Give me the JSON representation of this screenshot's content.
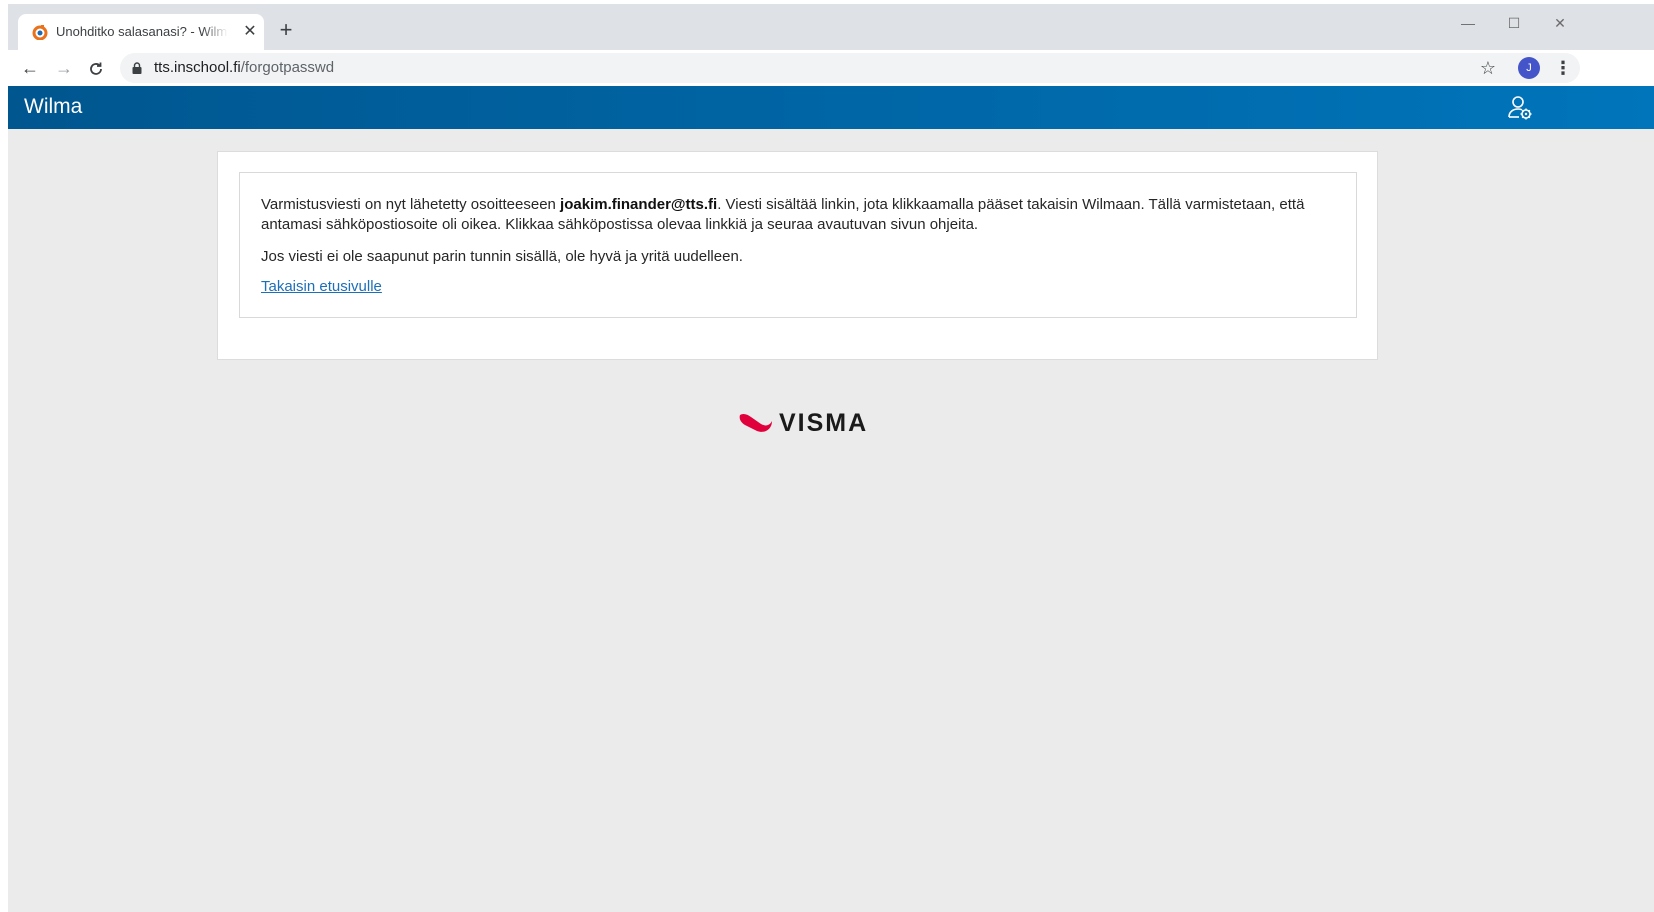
{
  "browser": {
    "tab_title": "Unohditko salasanasi? - Wilma - ",
    "tab_close": "✕",
    "new_tab": "+",
    "window_controls": {
      "minimize": "—",
      "maximize": "☐",
      "close": "✕"
    },
    "nav": {
      "back": "←",
      "forward": "→",
      "reload": "C"
    },
    "url_host": "tts.inschool.fi",
    "url_path": "/forgotpasswd",
    "star": "☆",
    "profile_initial": "J",
    "menu": "⋮",
    "accent_colors": {
      "favicon_ring": "#e8731c",
      "favicon_center": "#1c6bb4",
      "profile": "#4355c9"
    }
  },
  "app": {
    "brand": "Wilma",
    "header_gradient": [
      "#00568f",
      "#0075bb"
    ],
    "account_icon": "user-settings-icon"
  },
  "message": {
    "text_before": "Varmistusviesti on nyt lähetetty osoitteeseen ",
    "email": "joakim.finander@tts.fi",
    "text_after": ". Viesti sisältää linkin, jota klikkaamalla pääset takaisin Wilmaan. Tällä varmistetaan, että antamasi sähköpostiosoite oli oikea. Klikkaa sähköpostissa olevaa linkkiä ja seuraa avautuvan sivun ohjeita.",
    "retry_text": "Jos viesti ei ole saapunut parin tunnin sisällä, ole hyvä ja yritä uudelleen.",
    "back_link": "Takaisin etusivulle"
  },
  "footer": {
    "logo_text": "VISMA",
    "logo_color": "#e0003c"
  }
}
